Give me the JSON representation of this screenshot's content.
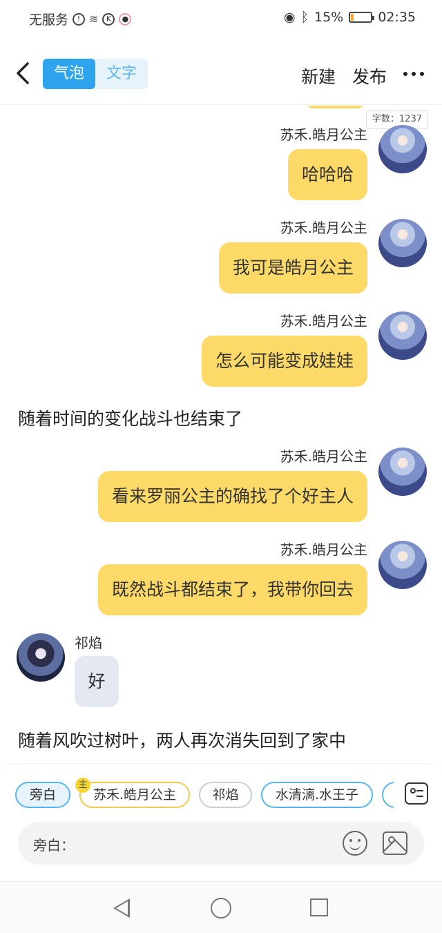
{
  "status_bar": {
    "carrier": "无服务",
    "battery": "15%",
    "battery_level": 0.15,
    "time": "02:35"
  },
  "header": {
    "tabs": [
      "气泡",
      "文字"
    ],
    "active_tab": "气泡",
    "new_label": "新建",
    "publish_label": "发布"
  },
  "word_count": "字数：1237",
  "messages": [
    {
      "type": "right",
      "sender": "苏禾.皓月公主",
      "text": "哈哈哈"
    },
    {
      "type": "right",
      "sender": "苏禾.皓月公主",
      "text": "我可是皓月公主"
    },
    {
      "type": "right",
      "sender": "苏禾.皓月公主",
      "text": "怎么可能变成娃娃"
    },
    {
      "type": "narration",
      "text": "随着时间的变化战斗也结束了"
    },
    {
      "type": "right",
      "sender": "苏禾.皓月公主",
      "text": "看来罗丽公主的确找了个好主人"
    },
    {
      "type": "right",
      "sender": "苏禾.皓月公主",
      "text": "既然战斗都结束了，我带你回去"
    },
    {
      "type": "left",
      "sender": "祁焰",
      "text": "好"
    },
    {
      "type": "narration",
      "text": "随着风吹过树叶，两人再次消失回到了家中"
    }
  ],
  "role_chips": [
    "旁白",
    "苏禾.皓月公主",
    "祁焰",
    "水清漓.水王子"
  ],
  "main_badge": "主",
  "input": {
    "label": "旁白："
  }
}
